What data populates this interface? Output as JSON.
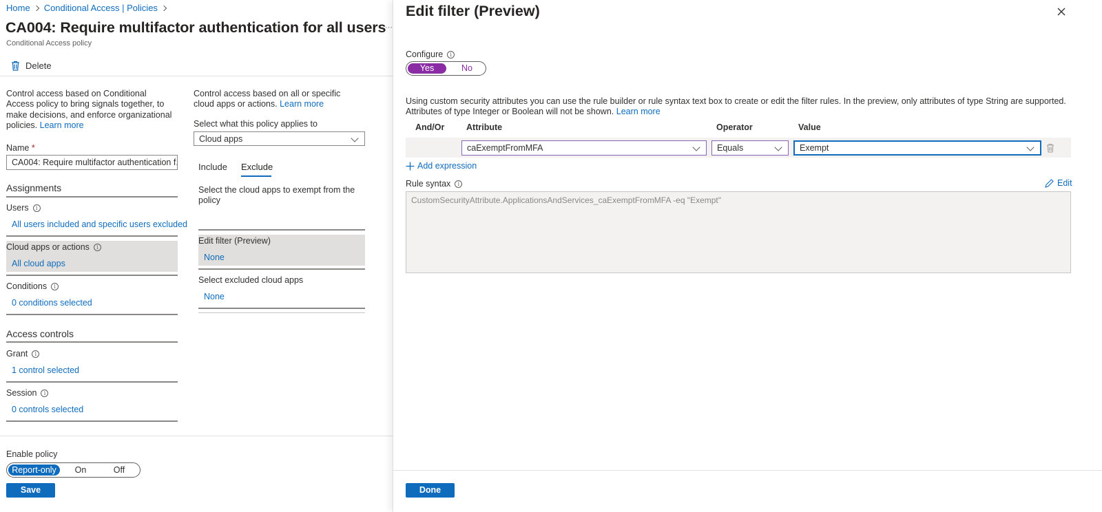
{
  "breadcrumb": {
    "home": "Home",
    "policies": "Conditional Access | Policies"
  },
  "header": {
    "title": "CA004: Require multifactor authentication for all users",
    "subtitle": "Conditional Access policy",
    "more": "···"
  },
  "toolbar": {
    "delete_label": "Delete"
  },
  "left": {
    "description": "Control access based on Conditional Access policy to bring signals together, to make decisions, and enforce organizational policies.",
    "learn_more": "Learn more",
    "name_label": "Name",
    "name_required": "*",
    "name_value": "CA004: Require multifactor authentication f...",
    "assignments_heading": "Assignments",
    "users_label": "Users",
    "users_value": "All users included and specific users excluded",
    "cloud_label": "Cloud apps or actions",
    "cloud_value": "All cloud apps",
    "conditions_label": "Conditions",
    "conditions_value": "0 conditions selected",
    "access_heading": "Access controls",
    "grant_label": "Grant",
    "grant_value": "1 control selected",
    "session_label": "Session",
    "session_value": "0 controls selected",
    "enable_label": "Enable policy",
    "enable_options": [
      "Report-only",
      "On",
      "Off"
    ],
    "save_label": "Save"
  },
  "middle": {
    "description": "Control access based on all or specific cloud apps or actions.",
    "learn_more": "Learn more",
    "applies_label": "Select what this policy applies to",
    "applies_value": "Cloud apps",
    "tab_include": "Include",
    "tab_exclude": "Exclude",
    "exempt_text": "Select the cloud apps to exempt from the policy",
    "filter_label": "Edit filter (Preview)",
    "filter_value": "None",
    "excluded_label": "Select excluded cloud apps",
    "excluded_value": "None"
  },
  "panel": {
    "title": "Edit filter (Preview)",
    "configure_label": "Configure",
    "yes": "Yes",
    "no": "No",
    "info_text": "Using custom security attributes you can use the rule builder or rule syntax text box to create or edit the filter rules. In the preview, only attributes of type String are supported. Attributes of type Integer or Boolean will not be shown.",
    "learn_more": "Learn more",
    "columns": {
      "andor": "And/Or",
      "attribute": "Attribute",
      "operator": "Operator",
      "value": "Value"
    },
    "row": {
      "attribute": "caExemptFromMFA",
      "operator": "Equals",
      "value": "Exempt"
    },
    "add_expression": "Add expression",
    "rule_syntax_label": "Rule syntax",
    "edit_label": "Edit",
    "rule_syntax_value": "CustomSecurityAttribute.ApplicationsAndServices_caExemptFromMFA -eq \"Exempt\"",
    "done_label": "Done"
  },
  "colors": {
    "accent": "#0f6cbd",
    "toggle_purple": "#8a2da5",
    "select_border_purple": "#8764b8"
  }
}
